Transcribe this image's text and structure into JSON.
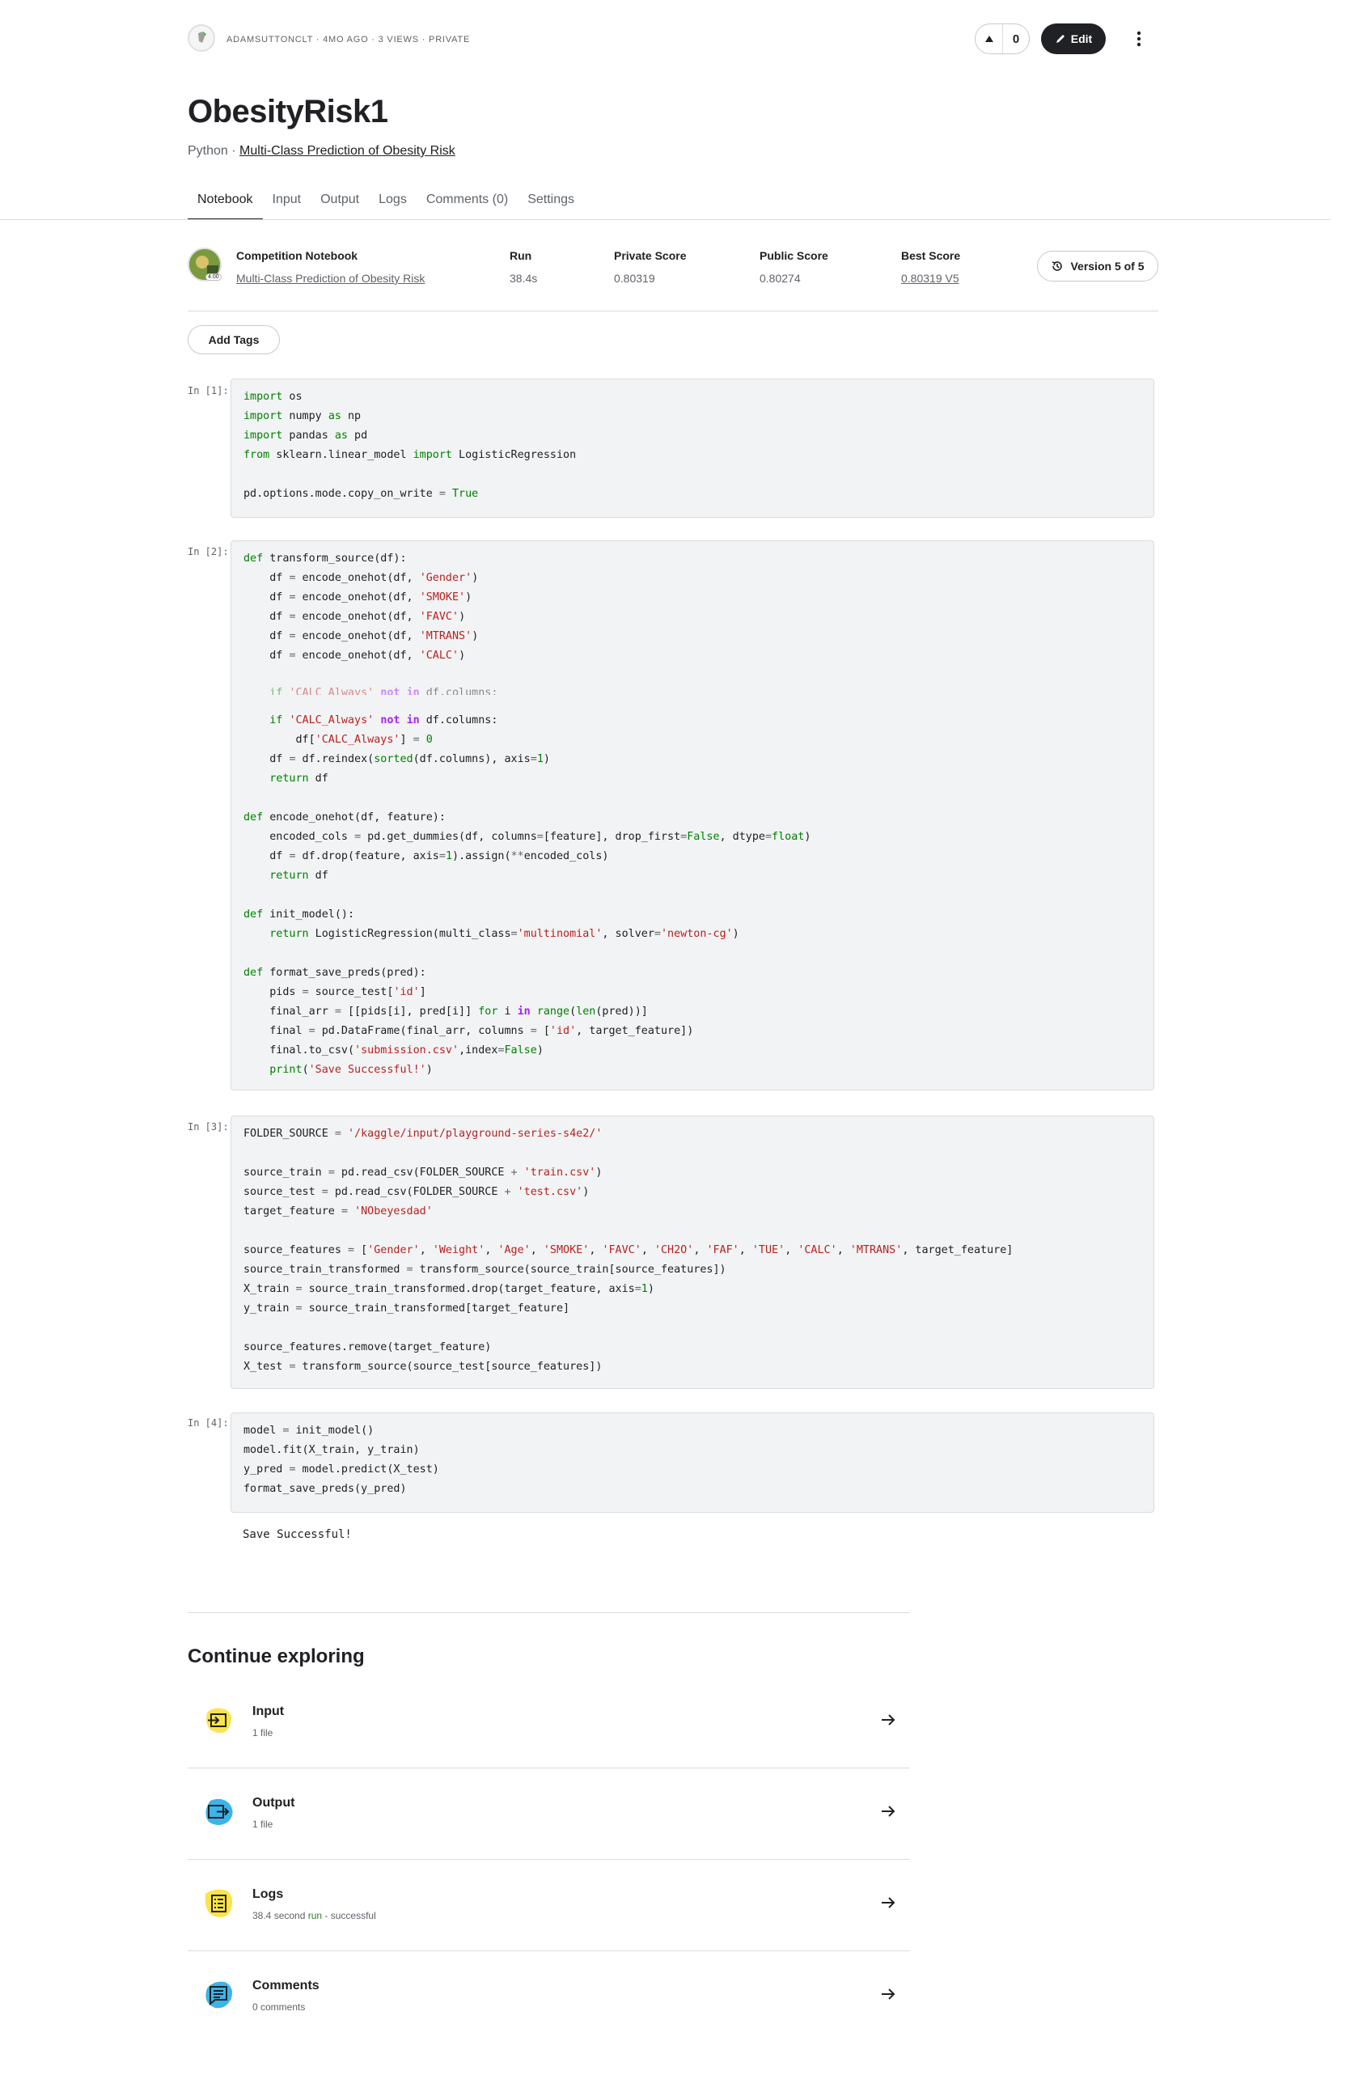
{
  "header": {
    "meta": "ADAMSUTTONCLT · 4MO AGO · 3 VIEWS · PRIVATE",
    "vote_count": "0",
    "edit_label": "Edit"
  },
  "title": "ObesityRisk1",
  "subtitle": {
    "language": "Python · ",
    "competition_link": "Multi-Class Prediction of Obesity Risk"
  },
  "tabs": [
    "Notebook",
    "Input",
    "Output",
    "Logs",
    "Comments (0)",
    "Settings"
  ],
  "competition": {
    "badge": "4.00",
    "label": "Competition Notebook",
    "link": "Multi-Class Prediction of Obesity Risk",
    "run_label": "Run",
    "run_value": "38.4s",
    "private_label": "Private Score",
    "private_value": "0.80319",
    "public_label": "Public Score",
    "public_value": "0.80274",
    "best_label": "Best Score",
    "best_value": "0.80319 V5",
    "version_label": "Version 5 of 5"
  },
  "add_tags_label": "Add Tags",
  "cells": [
    {
      "label": "In [1]:"
    },
    {
      "label": "In [2]:"
    },
    {
      "label": "In [3]:"
    },
    {
      "label": "In [4]:"
    }
  ],
  "output_text": "Save Successful!",
  "explore": {
    "title": "Continue exploring",
    "items": [
      {
        "name": "Input",
        "sub": "1 file",
        "icon": "input-icon"
      },
      {
        "name": "Output",
        "sub": "1 file",
        "icon": "output-icon"
      },
      {
        "name": "Logs",
        "sub_prefix": "38.4 second ",
        "sub_highlight": "run",
        "sub_suffix": " - successful",
        "icon": "logs-icon"
      },
      {
        "name": "Comments",
        "sub": "0 comments",
        "icon": "comments-icon"
      }
    ]
  },
  "colors": {
    "accent_dark": "#202124",
    "code_bg": "#f1f3f4",
    "keyword_green": "#008000",
    "string_red": "#ba2121",
    "keyword_purple": "#aa22ff",
    "icon_yellow": "#fbe34b",
    "icon_blue": "#3ab4ea"
  }
}
